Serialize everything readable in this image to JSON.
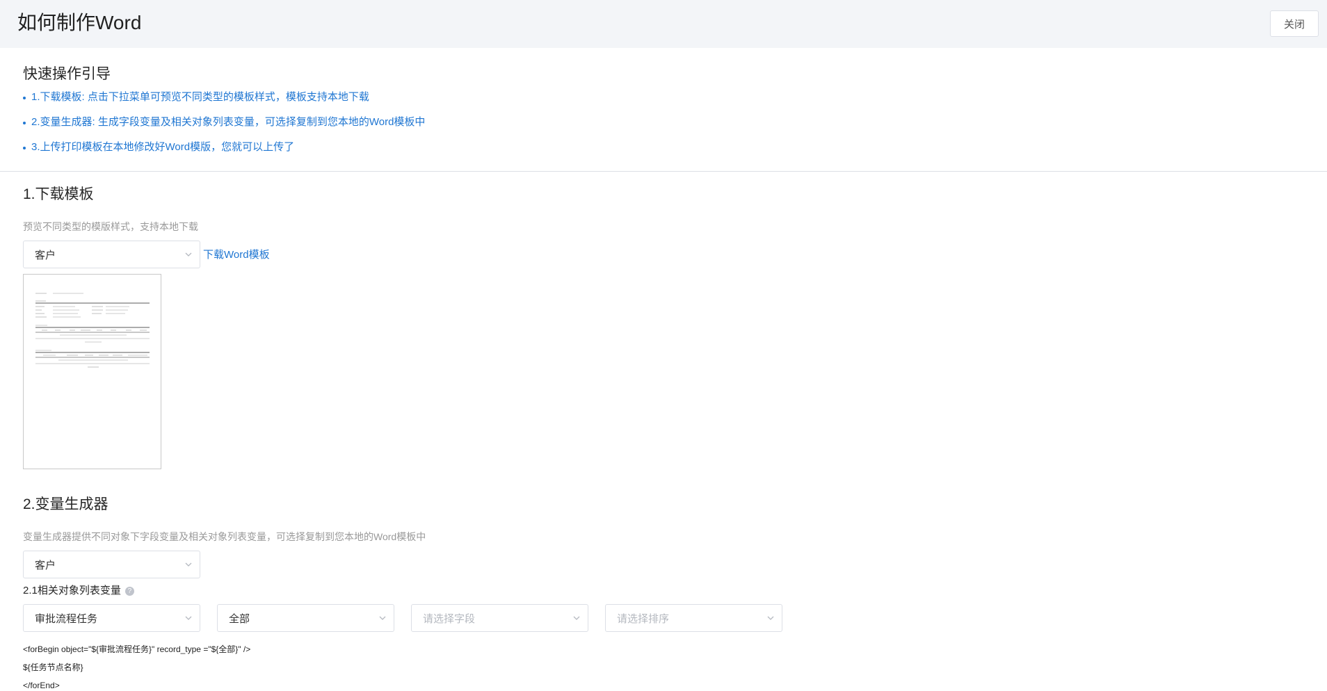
{
  "header": {
    "title": "如何制作Word",
    "close_label": "关闭"
  },
  "guide": {
    "heading": "快速操作引导",
    "items": [
      "1.下载模板: 点击下拉菜单可预览不同类型的模板样式，模板支持本地下载",
      "2.变量生成器: 生成字段变量及相关对象列表变量，可选择复制到您本地的Word模板中",
      "3.上传打印模板在本地修改好Word模版，您就可以上传了"
    ]
  },
  "download_section": {
    "title": "1.下载模板",
    "description": "预览不同类型的模版样式，支持本地下载",
    "object_select_value": "客户",
    "download_link": "下载Word模板"
  },
  "generator_section": {
    "title": "2.变量生成器",
    "description": "变量生成器提供不同对象下字段变量及相关对象列表变量，可选择复制到您本地的Word模板中",
    "object_select_value": "客户",
    "subsection_title": "2.1相关对象列表变量",
    "help_icon_glyph": "?",
    "related_object_select_value": "审批流程任务",
    "record_type_select_value": "全部",
    "field_select_placeholder": "请选择字段",
    "sort_select_placeholder": "请选择排序",
    "code_lines": [
      "<forBegin object=\"${审批流程任务}\" record_type =\"${全部}\" />",
      "${任务节点名称}",
      "</forEnd>"
    ]
  },
  "colors": {
    "link_blue": "#1f76d2",
    "header_bg": "#f3f5f8",
    "border": "#dcdfe6"
  },
  "icons": [
    "chevron-down-icon",
    "help-icon",
    "list-bullet-icon"
  ]
}
